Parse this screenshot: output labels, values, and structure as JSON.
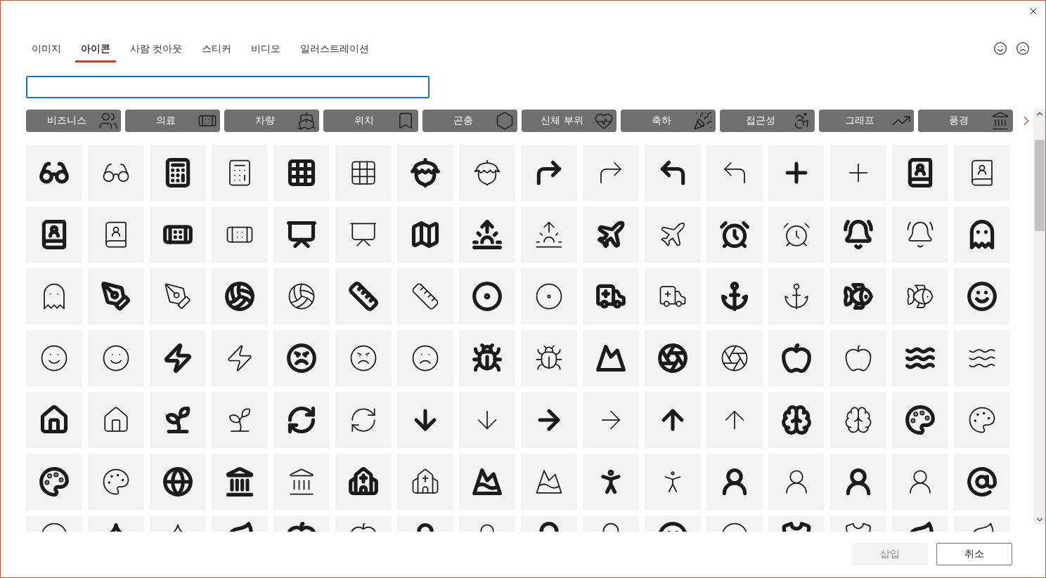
{
  "tabs": [
    {
      "label": "이미지",
      "selected": false
    },
    {
      "label": "아이콘",
      "selected": true
    },
    {
      "label": "사람 컷아웃",
      "selected": false
    },
    {
      "label": "스티커",
      "selected": false
    },
    {
      "label": "비디오",
      "selected": false
    },
    {
      "label": "일러스트레이션",
      "selected": false
    }
  ],
  "categories": [
    "비즈니스",
    "의료",
    "차량",
    "위치",
    "곤충",
    "신체 부위",
    "축하",
    "접근성",
    "그래프",
    "풍경"
  ],
  "buttons": [
    {
      "label": "삽입",
      "disabled": true
    },
    {
      "label": "취소",
      "disabled": false
    }
  ]
}
